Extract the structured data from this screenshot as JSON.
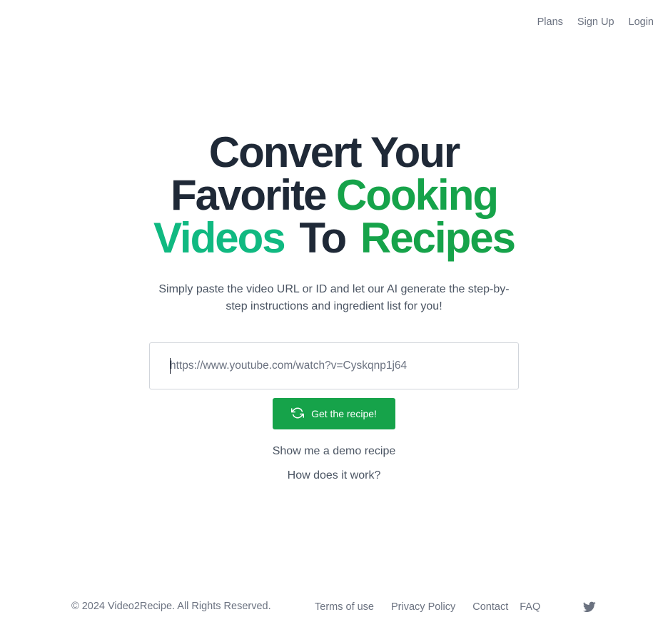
{
  "nav": {
    "plans": "Plans",
    "signup": "Sign Up",
    "login": "Login"
  },
  "hero": {
    "line1": "Convert Your",
    "line2_dark": "Favorite",
    "line2_green": "Cooking",
    "line3_teal": "Videos",
    "line3_dark": "To",
    "line3_green": "Recipes",
    "subtitle": "Simply paste the video URL or ID and let our AI generate the step-by-step instructions and ingredient list for you!"
  },
  "form": {
    "url_placeholder": "https://www.youtube.com/watch?v=Cyskqnp1j64",
    "submit_label": "Get the recipe!"
  },
  "links": {
    "demo": "Show me a demo recipe",
    "how": "How does it work?"
  },
  "footer": {
    "copyright": "© 2024 Video2Recipe. All Rights Reserved.",
    "terms": "Terms of use",
    "privacy": "Privacy Policy",
    "contact": "Contact",
    "faq": "FAQ"
  },
  "icons": {
    "submit": "refresh-icon",
    "social": "twitter-icon"
  },
  "colors": {
    "accent_green": "#16a34a",
    "accent_teal": "#10b981",
    "heading": "#1f2937",
    "muted": "#6b7280"
  }
}
